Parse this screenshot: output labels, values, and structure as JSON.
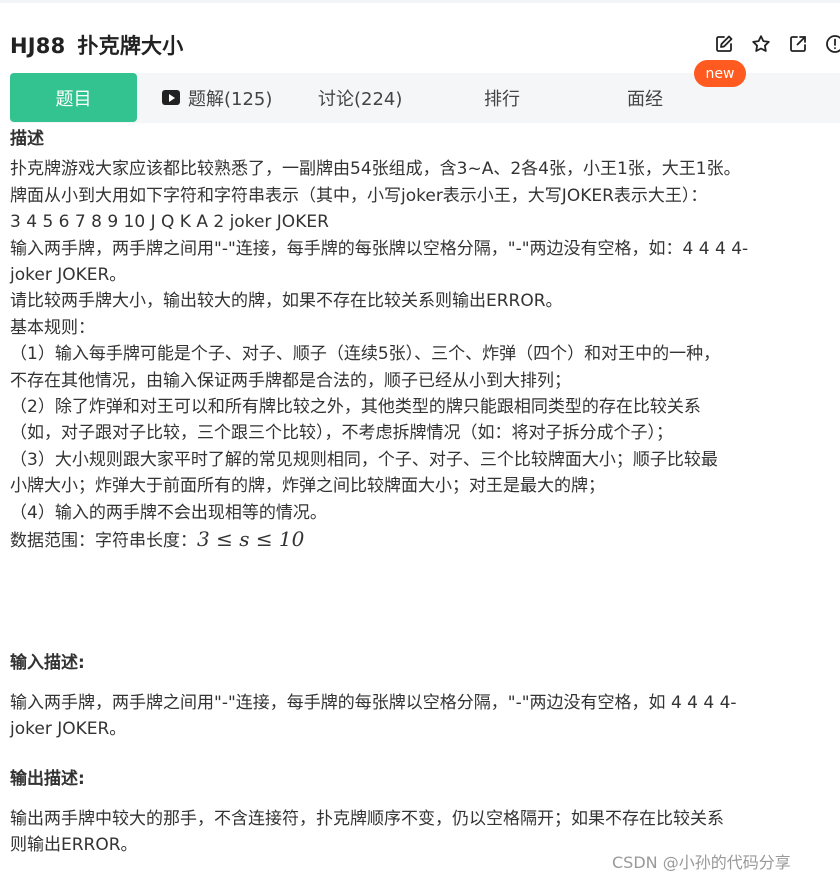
{
  "problem": {
    "code": "HJ88",
    "name": "扑克牌大小"
  },
  "actions": [
    {
      "icon": "edit-icon"
    },
    {
      "icon": "star-icon"
    },
    {
      "icon": "share-icon"
    },
    {
      "icon": "info-icon"
    }
  ],
  "tabs": [
    {
      "label": "题目"
    },
    {
      "label": "题解(125)",
      "icon": "video-icon"
    },
    {
      "label": "讨论(224)"
    },
    {
      "label": "排行"
    },
    {
      "label": "面经"
    }
  ],
  "badge": "new",
  "description": {
    "heading": "描述",
    "lines": [
      "扑克牌游戏大家应该都比较熟悉了，一副牌由54张组成，含3~A、2各4张，小王1张，大王1张。",
      "牌面从小到大用如下字符和字符串表示（其中，小写joker表示小王，大写JOKER表示大王）：",
      "3 4 5 6 7 8 9 10 J Q K A 2 joker JOKER",
      "输入两手牌，两手牌之间用\"-\"连接，每手牌的每张牌以空格分隔，\"-\"两边没有空格，如：4 4 4 4-",
      "joker JOKER。",
      "请比较两手牌大小，输出较大的牌，如果不存在比较关系则输出ERROR。",
      "基本规则：",
      "（1）输入每手牌可能是个子、对子、顺子（连续5张）、三个、炸弹（四个）和对王中的一种，",
      "不存在其他情况，由输入保证两手牌都是合法的，顺子已经从小到大排列；",
      "（2）除了炸弹和对王可以和所有牌比较之外，其他类型的牌只能跟相同类型的存在比较关系",
      "（如，对子跟对子比较，三个跟三个比较），不考虑拆牌情况（如：将对子拆分成个子）；",
      "（3）大小规则跟大家平时了解的常见规则相同，个子、对子、三个比较牌面大小；顺子比较最",
      "小牌大小；炸弹大于前面所有的牌，炸弹之间比较牌面大小；对王是最大的牌；",
      "（4）输入的两手牌不会出现相等的情况。"
    ],
    "range_label": "数据范围：字符串长度：",
    "range_formula": "3 ≤ s ≤ 10"
  },
  "input_desc": {
    "heading": "输入描述:",
    "lines": [
      "输入两手牌，两手牌之间用\"-\"连接，每手牌的每张牌以空格分隔，\"-\"两边没有空格，如 4 4 4 4-",
      "joker JOKER。"
    ]
  },
  "output_desc": {
    "heading": "输出描述:",
    "lines": [
      "输出两手牌中较大的那手，不含连接符，扑克牌顺序不变，仍以空格隔开；如果不存在比较关系",
      "则输出ERROR。"
    ]
  },
  "watermark": "CSDN @小孙的代码分享",
  "colors": {
    "accent": "#32c391",
    "badge": "#ff5a1f",
    "tab_bg": "#f5f6f8",
    "text": "#333333"
  }
}
